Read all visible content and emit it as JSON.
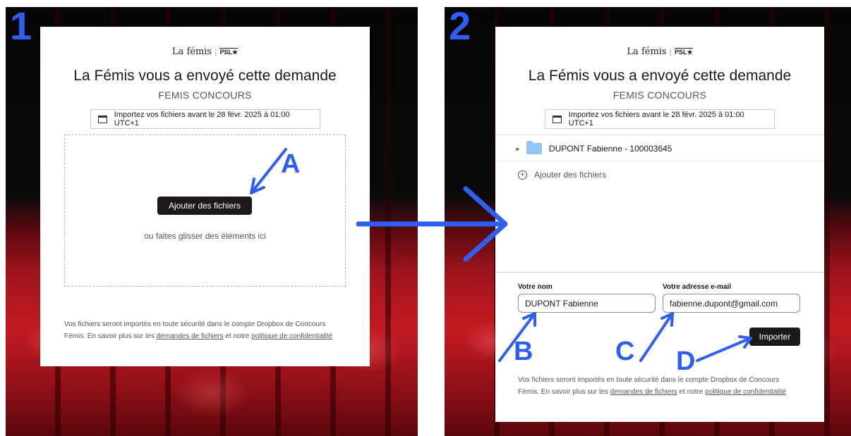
{
  "steps": [
    "1",
    "2"
  ],
  "logo": {
    "name": "La fémis",
    "separator": "|",
    "partner": "PSL★"
  },
  "title": "La Fémis vous a envoyé cette demande",
  "subtitle": "FEMIS CONCOURS",
  "deadline": "Importez vos fichiers avant le 28 févr. 2025 à 01:00 UTC+1",
  "dropzone": {
    "add_button": "Ajouter des fichiers",
    "drag_text": "ou faites glisser des éléments ici"
  },
  "footer": {
    "text_1": "Vos fichiers seront importés en toute sécurité dans le compte Dropbox de Concours Fémis. En savoir plus sur les ",
    "link_requests": "demandes de fichiers",
    "text_2": " et notre ",
    "link_privacy": "politique de confidentialité"
  },
  "file_list": {
    "folder_name": "DUPONT Fabienne - 100003645",
    "add_files": "Ajouter des fichiers"
  },
  "form": {
    "name_label": "Votre nom",
    "name_value": "DUPONT Fabienne",
    "email_label": "Votre adresse e-mail",
    "email_value": "fabienne.dupont@gmail.com",
    "submit": "Importer"
  },
  "annotations": [
    "A",
    "B",
    "C",
    "D"
  ],
  "colors": {
    "accent": "#2f5ff0",
    "button_dark": "#1e1919",
    "folder": "#90c5f5"
  },
  "icons": [
    "calendar-icon",
    "caret-right-icon",
    "folder-icon",
    "plus-circle-icon"
  ]
}
